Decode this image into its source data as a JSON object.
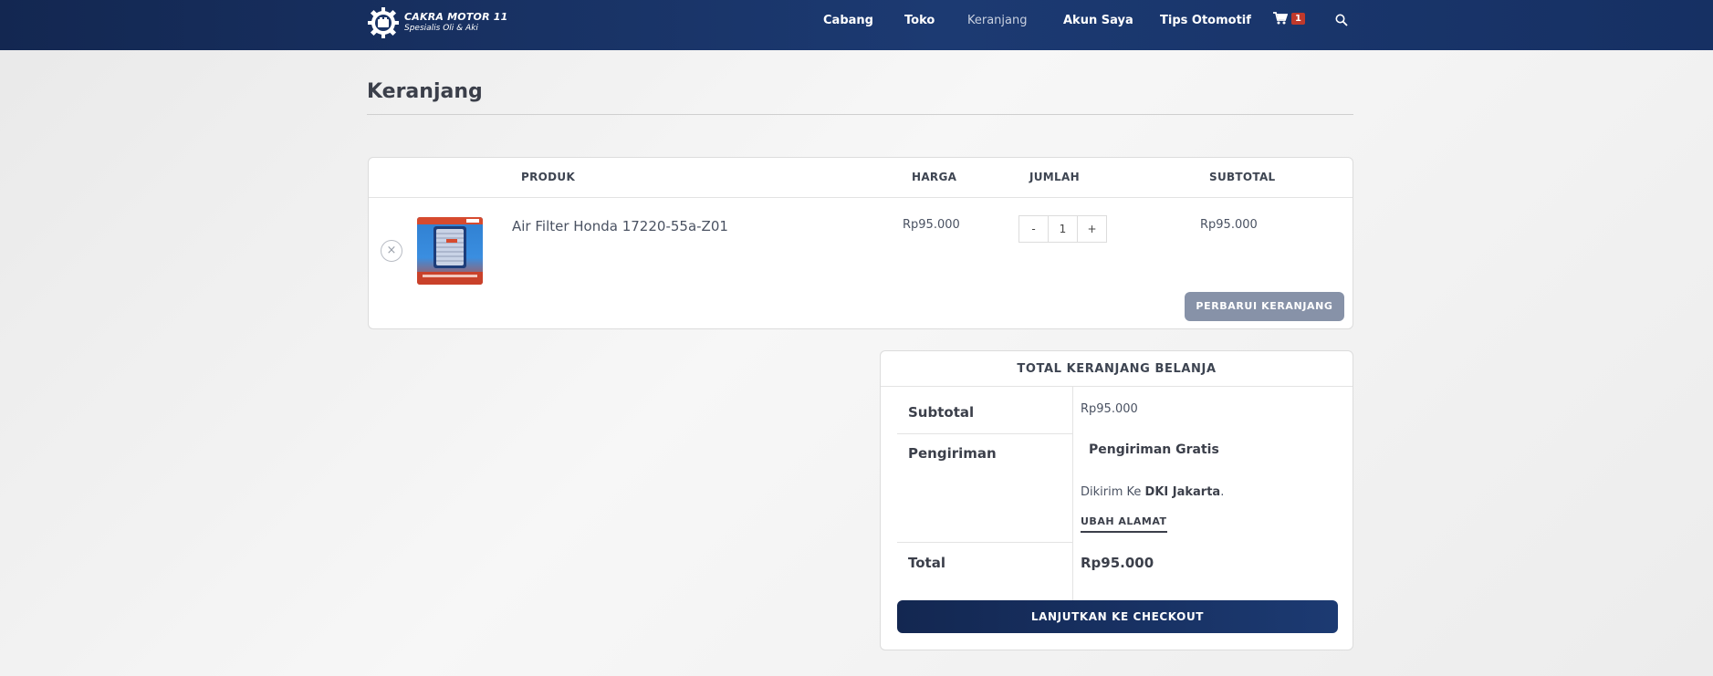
{
  "brand": {
    "title": "CAKRA MOTOR 11",
    "subtitle": "Spesialis Oli & Aki"
  },
  "nav": {
    "items": [
      {
        "label": "Cabang"
      },
      {
        "label": "Toko"
      },
      {
        "label": "Keranjang"
      },
      {
        "label": "Akun Saya"
      },
      {
        "label": "Tips Otomotif"
      }
    ],
    "cart_count": "1"
  },
  "page": {
    "title": "Keranjang"
  },
  "cart": {
    "headers": {
      "product": "PRODUK",
      "price": "HARGA",
      "qty": "JUMLAH",
      "subtotal": "SUBTOTAL"
    },
    "items": [
      {
        "name": "Air Filter Honda 17220-55a-Z01",
        "price": "Rp95.000",
        "qty_minus": "-",
        "qty": "1",
        "qty_plus": "+",
        "subtotal": "Rp95.000",
        "remove": "×"
      }
    ],
    "update_label": "PERBARUI KERANJANG"
  },
  "totals": {
    "heading": "TOTAL KERANJANG BELANJA",
    "subtotal_label": "Subtotal",
    "subtotal_value": "Rp95.000",
    "shipping_label": "Pengiriman",
    "shipping_method": "Pengiriman Gratis",
    "shipping_to_prefix": "Dikirim Ke ",
    "shipping_to_region": "DKI Jakarta",
    "shipping_to_suffix": ".",
    "change_address": "UBAH ALAMAT",
    "total_label": "Total",
    "total_value": "Rp95.000",
    "checkout_label": "LANJUTKAN KE CHECKOUT"
  },
  "colors": {
    "header": "#1c3a72",
    "badge": "#c0392b",
    "update_button": "#8792a8"
  }
}
